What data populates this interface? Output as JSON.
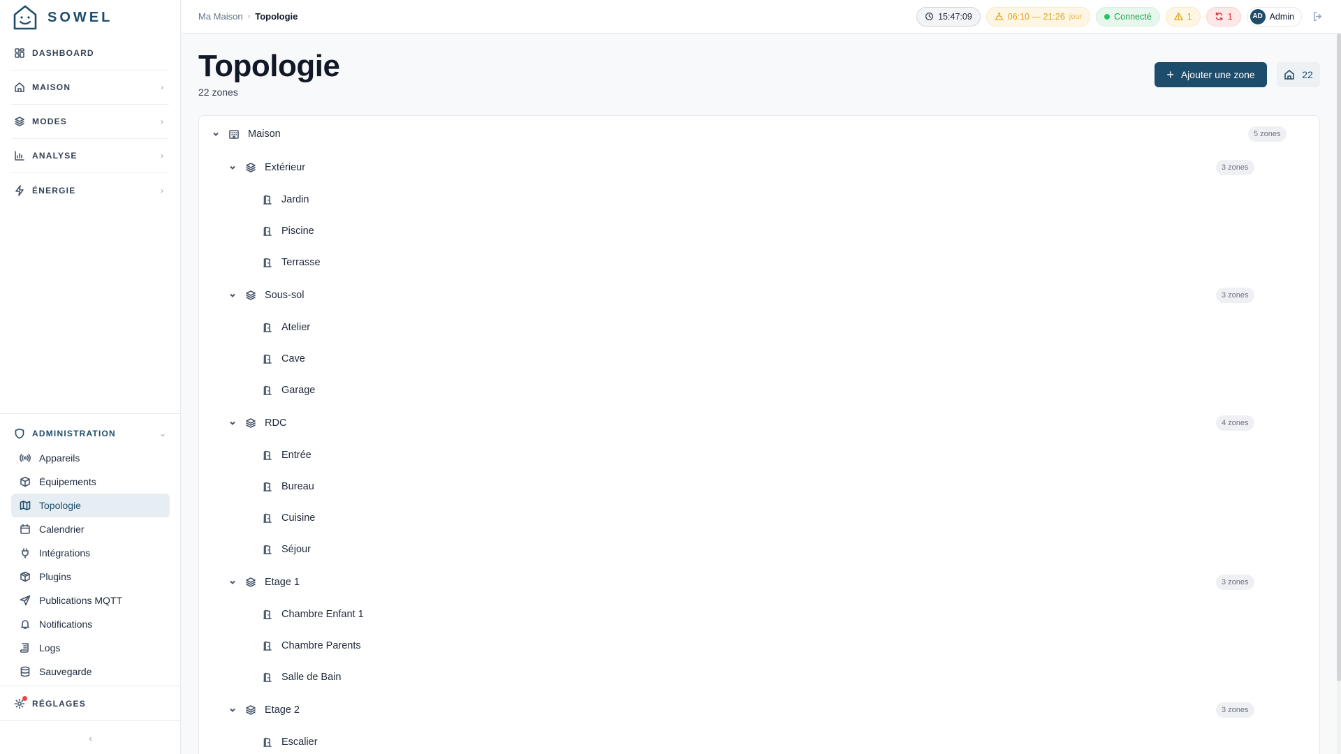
{
  "app": {
    "name": "SOWEL"
  },
  "sidebar": {
    "main": [
      {
        "label": "DASHBOARD",
        "icon": "grid-icon",
        "has_chevron": false
      },
      {
        "label": "MAISON",
        "icon": "home-icon",
        "has_chevron": true
      },
      {
        "label": "MODES",
        "icon": "layers-icon",
        "has_chevron": true
      },
      {
        "label": "ANALYSE",
        "icon": "bar-chart-icon",
        "has_chevron": true
      },
      {
        "label": "ÉNERGIE",
        "icon": "bolt-icon",
        "has_chevron": true
      }
    ],
    "admin": {
      "label": "ADMINISTRATION",
      "items": [
        {
          "label": "Appareils",
          "icon": "radio-icon"
        },
        {
          "label": "Équipements",
          "icon": "box-icon"
        },
        {
          "label": "Topologie",
          "icon": "map-icon",
          "active": true
        },
        {
          "label": "Calendrier",
          "icon": "calendar-icon"
        },
        {
          "label": "Intégrations",
          "icon": "plug-icon"
        },
        {
          "label": "Plugins",
          "icon": "package-icon"
        },
        {
          "label": "Publications MQTT",
          "icon": "send-icon"
        },
        {
          "label": "Notifications",
          "icon": "bell-icon"
        },
        {
          "label": "Logs",
          "icon": "scroll-icon"
        },
        {
          "label": "Sauvegarde",
          "icon": "database-icon"
        }
      ]
    },
    "settings_label": "RÉGLAGES"
  },
  "topbar": {
    "breadcrumb": {
      "root": "Ma Maison",
      "current": "Topologie"
    },
    "time": "15:47:09",
    "sun": {
      "range": "06:10 — 21:26",
      "phase": "jour"
    },
    "connection": "Connecté",
    "warnings": "1",
    "errors": "1",
    "user": {
      "initials": "AD",
      "name": "Admin"
    }
  },
  "page": {
    "title": "Topologie",
    "subtitle": "22 zones",
    "add_button": "Ajouter une zone",
    "zone_count": "22"
  },
  "tree": [
    {
      "level": 0,
      "name": "Maison",
      "type": "building",
      "badge": "5 zones",
      "expanded": true
    },
    {
      "level": 1,
      "name": "Extérieur",
      "type": "floor",
      "badge": "3 zones",
      "expanded": true
    },
    {
      "level": 2,
      "name": "Jardin",
      "type": "room"
    },
    {
      "level": 2,
      "name": "Piscine",
      "type": "room"
    },
    {
      "level": 2,
      "name": "Terrasse",
      "type": "room"
    },
    {
      "level": 1,
      "name": "Sous-sol",
      "type": "floor",
      "badge": "3 zones",
      "expanded": true
    },
    {
      "level": 2,
      "name": "Atelier",
      "type": "room"
    },
    {
      "level": 2,
      "name": "Cave",
      "type": "room"
    },
    {
      "level": 2,
      "name": "Garage",
      "type": "room"
    },
    {
      "level": 1,
      "name": "RDC",
      "type": "floor",
      "badge": "4 zones",
      "expanded": true
    },
    {
      "level": 2,
      "name": "Entrée",
      "type": "room"
    },
    {
      "level": 2,
      "name": "Bureau",
      "type": "room"
    },
    {
      "level": 2,
      "name": "Cuisine",
      "type": "room"
    },
    {
      "level": 2,
      "name": "Séjour",
      "type": "room"
    },
    {
      "level": 1,
      "name": "Etage 1",
      "type": "floor",
      "badge": "3 zones",
      "expanded": true
    },
    {
      "level": 2,
      "name": "Chambre Enfant 1",
      "type": "room"
    },
    {
      "level": 2,
      "name": "Chambre Parents",
      "type": "room"
    },
    {
      "level": 2,
      "name": "Salle de Bain",
      "type": "room"
    },
    {
      "level": 1,
      "name": "Etage 2",
      "type": "floor",
      "badge": "3 zones",
      "expanded": true
    },
    {
      "level": 2,
      "name": "Escalier",
      "type": "room"
    }
  ],
  "colors": {
    "brand": "#1e4d6b",
    "connected": "#16a34a",
    "warning": "#e0a21b",
    "error": "#dc2626"
  }
}
